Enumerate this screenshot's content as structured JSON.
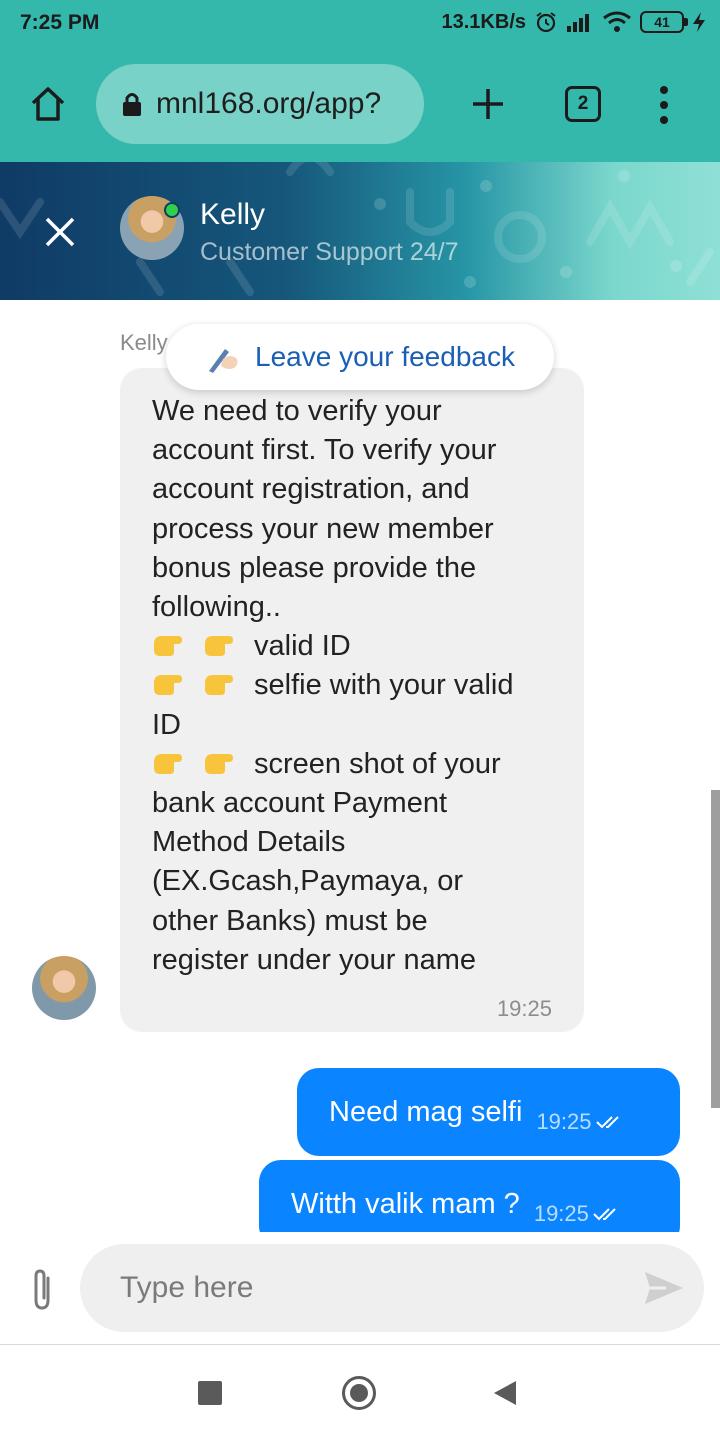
{
  "status_bar": {
    "time": "7:25 PM",
    "network_speed": "13.1KB/s",
    "battery_level": "41",
    "icons": [
      "alarm-icon",
      "signal-icon",
      "wifi-icon",
      "battery-icon",
      "charging-icon"
    ]
  },
  "browser": {
    "url": "mnl168.org/app?",
    "tab_count": "2",
    "icons": [
      "home-icon",
      "lock-icon",
      "plus-icon",
      "tabs-icon",
      "more-vert-icon"
    ]
  },
  "chat_header": {
    "agent_name": "Kelly",
    "agent_subtitle": "Customer Support 24/7",
    "online_color": "#2fd04b"
  },
  "messages": {
    "sender_label": "Kelly",
    "feedback_label": "Leave your feedback",
    "incoming": {
      "lines": [
        "We need to verify your",
        "account first. To verify your",
        "account registration, and",
        "process your new member",
        "bonus please provide the",
        "following..",
        "valid ID",
        "selfie with your valid",
        "ID",
        "screen shot of your",
        "bank account Payment",
        "Method Details",
        "(EX.Gcash,Paymaya, or",
        "other Banks) must be",
        "register under your name"
      ],
      "time": "19:25"
    },
    "outgoing": [
      {
        "text": "Need mag selfi",
        "time": "19:25"
      },
      {
        "text": "Witth valik mam ?",
        "time": "19:25"
      }
    ]
  },
  "composer": {
    "placeholder": "Type here"
  },
  "colors": {
    "brand_teal": "#35b8ac",
    "outgoing_bubble": "#0a84ff",
    "incoming_bubble": "#f0f0f0",
    "link_blue": "#1a5fb4"
  }
}
